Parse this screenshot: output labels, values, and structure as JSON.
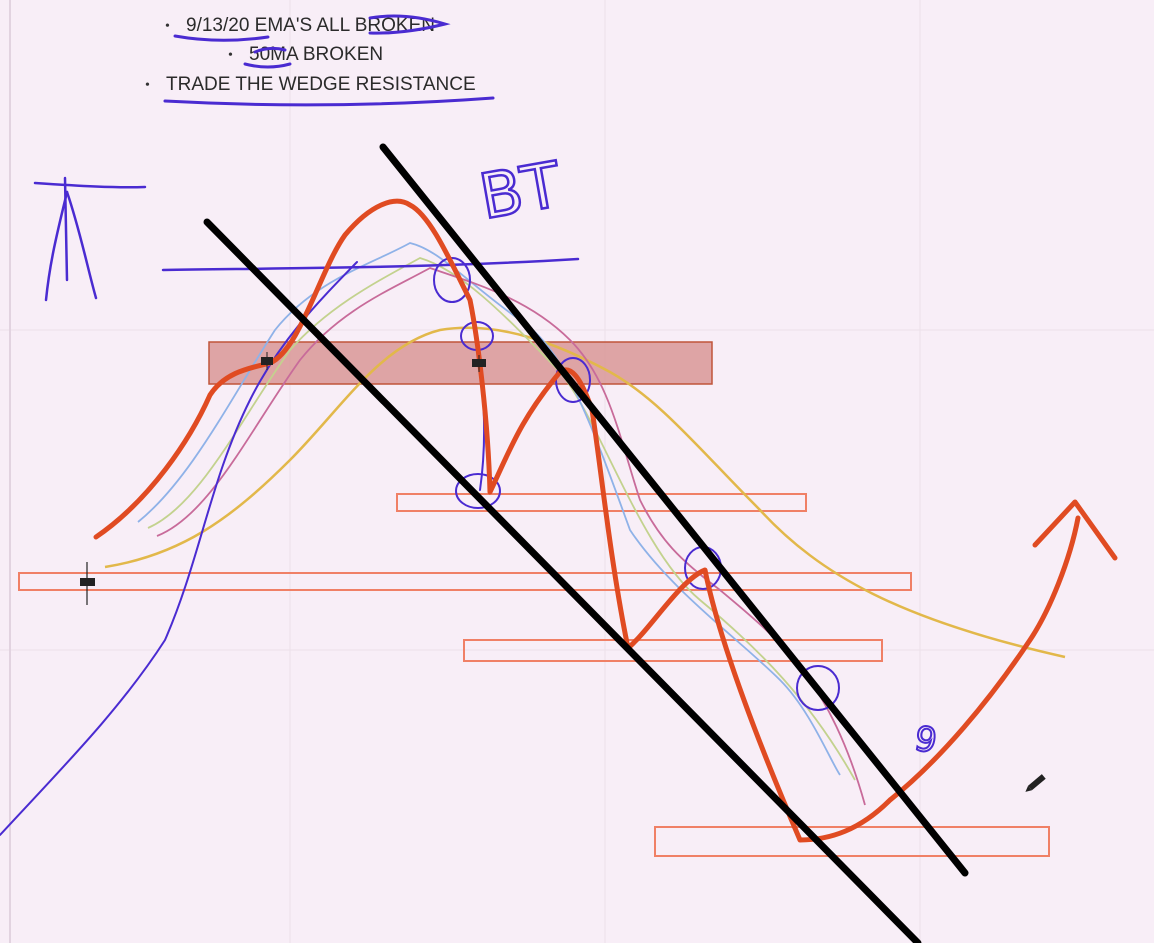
{
  "notes": [
    {
      "bullet": "•",
      "text": "9/13/20 EMA'S ALL BROKEN"
    },
    {
      "bullet": "•",
      "text": "50MA BROKEN"
    },
    {
      "bullet": "•",
      "text": "TRADE THE WEDGE RESISTANCE"
    }
  ],
  "handwriting": {
    "bt": "BT",
    "nine": "9"
  },
  "colors": {
    "background": "#f8eef7",
    "grid": "#ece0ea",
    "price_line": "#e04b22",
    "wedge_lines": "#000000",
    "annotation_ink": "#4a2bd1",
    "ema_blue": "#8fb2e8",
    "ema_green": "#c3d28e",
    "ema_pink": "#c86b9a",
    "ma50_yellow": "#e2b84a",
    "zone_fill": "#d99797",
    "zone_stroke": "#c0553a",
    "level_stroke": "#f08066"
  },
  "icons": [
    "pencil-icon"
  ]
}
